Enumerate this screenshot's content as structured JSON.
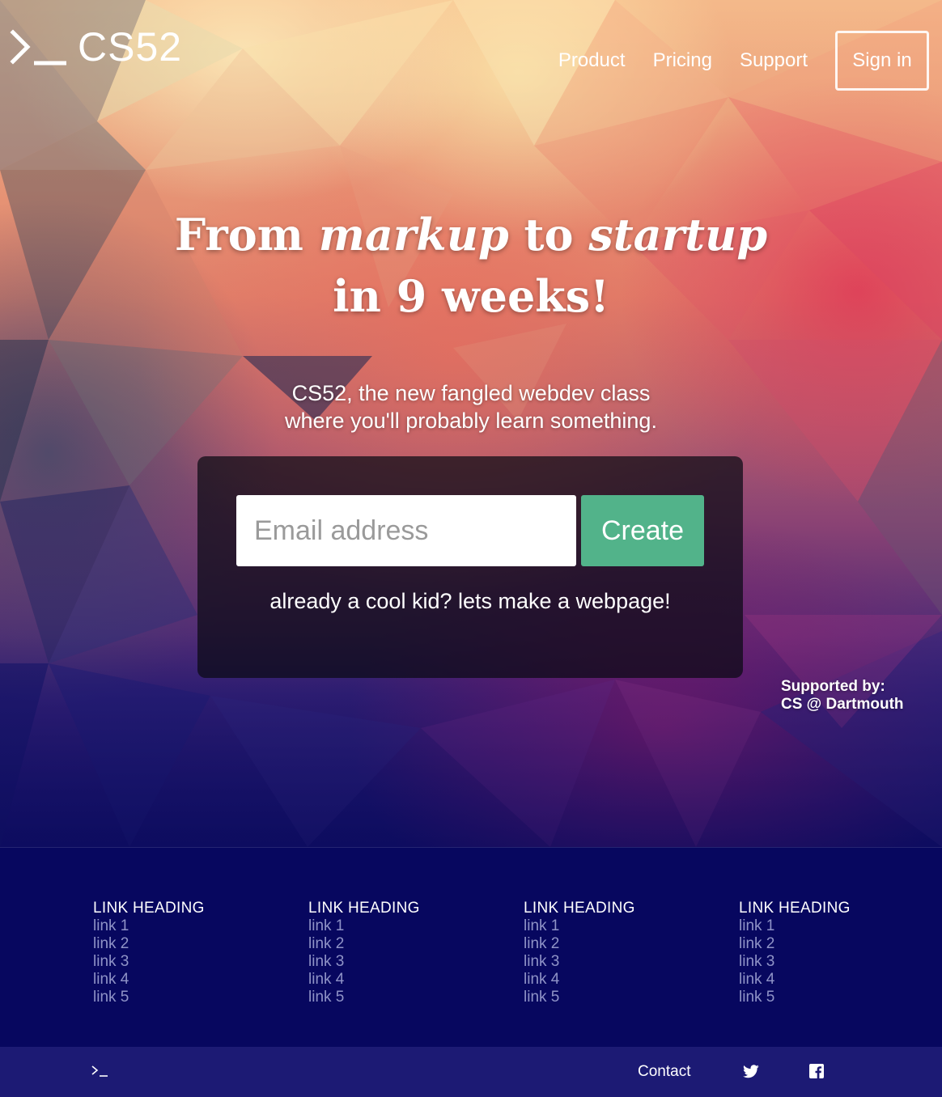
{
  "brand": {
    "name": "CS52",
    "icon": "terminal-prompt-icon"
  },
  "nav": {
    "links": [
      "Product",
      "Pricing",
      "Support"
    ],
    "sign_in": "Sign in"
  },
  "hero": {
    "headline": {
      "from": "From",
      "markup": "markup",
      "to": "to",
      "startup": "startup",
      "line2": "in 9 weeks!"
    },
    "tagline_line1": "CS52, the new fangled webdev class",
    "tagline_line2": "where you'll probably learn something."
  },
  "signup": {
    "email_placeholder": "Email address",
    "create_label": "Create",
    "cool_kid": "already a cool kid? lets make a webpage!"
  },
  "supported": {
    "line1": "Supported by:",
    "line2": "CS @ Dartmouth"
  },
  "footer": {
    "columns": [
      {
        "heading": "LINK HEADING",
        "links": [
          "link 1",
          "link 2",
          "link 3",
          "link 4",
          "link 5"
        ]
      },
      {
        "heading": "LINK HEADING",
        "links": [
          "link 1",
          "link 2",
          "link 3",
          "link 4",
          "link 5"
        ]
      },
      {
        "heading": "LINK HEADING",
        "links": [
          "link 1",
          "link 2",
          "link 3",
          "link 4",
          "link 5"
        ]
      },
      {
        "heading": "LINK HEADING",
        "links": [
          "link 1",
          "link 2",
          "link 3",
          "link 4",
          "link 5"
        ]
      }
    ]
  },
  "bottom_bar": {
    "contact": "Contact",
    "icons": [
      "terminal-prompt-icon",
      "twitter-icon",
      "facebook-icon"
    ]
  },
  "colors": {
    "create_button": "#52b38a",
    "footer_bg": "#07075f",
    "bottom_bar_bg": "#1c1a74",
    "footer_link": "#8f93c7"
  }
}
